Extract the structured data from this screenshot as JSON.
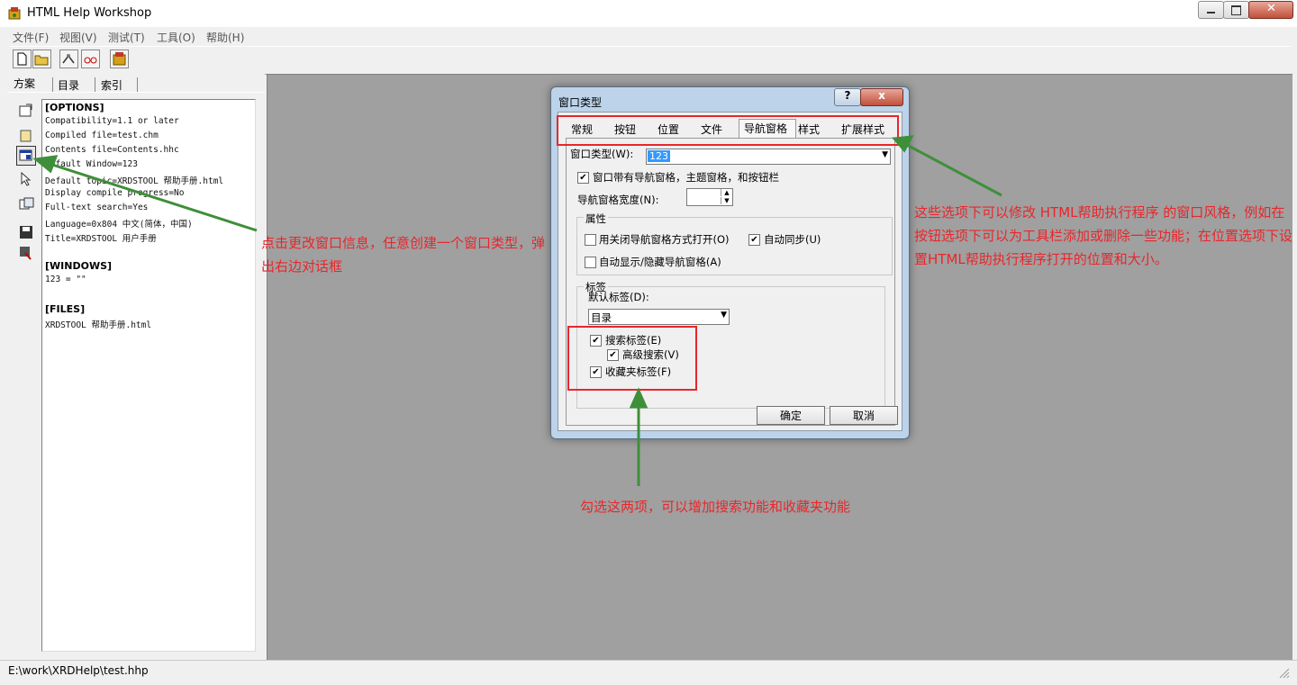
{
  "window": {
    "title": "HTML Help Workshop"
  },
  "menu": [
    "文件(F)",
    "视图(V)",
    "测试(T)",
    "工具(O)",
    "帮助(H)"
  ],
  "panel_tabs": [
    "方案",
    "目录",
    "索引"
  ],
  "editor": {
    "options_header": "[OPTIONS]",
    "options_lines": [
      "Compatibility=1.1 or later",
      "Compiled file=test.chm",
      "Contents file=Contents.hhc",
      "Default Window=123",
      "Default topic=XRDSTOOL 帮助手册.html",
      "Display compile progress=No",
      "Full-text search=Yes",
      "Language=0x804 中文(简体，中国)",
      "Title=XRDSTOOL 用户手册"
    ],
    "windows_header": "[WINDOWS]",
    "windows_lines": [
      "123 = \"\""
    ],
    "files_header": "[FILES]",
    "files_lines": [
      "XRDSTOOL 帮助手册.html"
    ]
  },
  "status": "E:\\work\\XRDHelp\\test.hhp",
  "dialog": {
    "title": "窗口类型",
    "help_btn": "?",
    "close_btn": "x",
    "tabs": [
      "常规",
      "按钮",
      "位置",
      "文件",
      "导航窗格",
      "样式",
      "扩展样式"
    ],
    "window_type_label": "窗口类型(W):",
    "window_type_value": "123",
    "nav_pane_check": "窗口带有导航窗格，主题窗格，和按钮栏",
    "nav_width_label": "导航窗格宽度(N):",
    "props_group": "属性",
    "close_nav_check": "用关闭导航窗格方式打开(O)",
    "auto_sync_check": "自动同步(U)",
    "auto_show_check": "自动显示/隐藏导航窗格(A)",
    "tabs_group": "标签",
    "default_tab_label": "默认标签(D):",
    "default_tab_value": "目录",
    "search_tab_check": "搜索标签(E)",
    "adv_search_check": "高级搜索(V)",
    "fav_tab_check": "收藏夹标签(F)",
    "ok": "确定",
    "cancel": "取消"
  },
  "annotations": {
    "left": "点击更改窗口信息，任意创建一个窗口类型，弹出右边对话框",
    "right": "这些选项下可以修改 HTML帮助执行程序 的窗口风格，例如在按钮选项下可以为工具栏添加或删除一些功能；在位置选项下设置HTML帮助执行程序打开的位置和大小。",
    "bottom": "勾选这两项，可以增加搜索功能和收藏夹功能"
  },
  "colors": {
    "annotation_red": "#e8262b",
    "arrow_green": "#3f8f3a",
    "workspace_gray": "#a0a0a0"
  },
  "icons": [
    "app-icon",
    "new-file-icon",
    "open-folder-icon",
    "compile-icon",
    "view-compiled-icon",
    "help-icon",
    "change-options-icon",
    "edit-window-icon",
    "add-topic-icon",
    "save-icon"
  ]
}
